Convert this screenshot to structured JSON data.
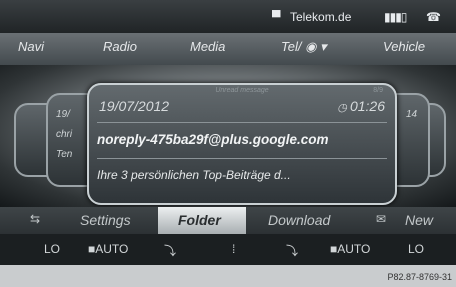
{
  "status": {
    "carrier": "Telekom.de",
    "signal_icon": "signal-bars-icon",
    "phone_icon": "phone-icon"
  },
  "nav": [
    "Navi",
    "Radio",
    "Media",
    "Tel/",
    "Vehicle"
  ],
  "message": {
    "heading": "Unread message",
    "counter": "8/9",
    "date": "19/07/2012",
    "time": "01:26",
    "sender": "noreply-475ba29f@plus.google.com",
    "preview": "Ihre 3 persönlichen Top-Beiträge d..."
  },
  "side_cards": {
    "left": [
      "19/",
      "chri",
      "Ten"
    ],
    "right": [
      "14"
    ]
  },
  "menu": {
    "settings": "Settings",
    "folder": "Folder",
    "download": "Download",
    "new": "New"
  },
  "climate": {
    "left_lo": "LO",
    "left_auto": "AUTO",
    "right_auto": "AUTO",
    "right_lo": "LO"
  },
  "ref": "P82.87-8769-31",
  "colors": {
    "highlight": "#e2e5e6",
    "screen_bg": "#0d0f10"
  }
}
